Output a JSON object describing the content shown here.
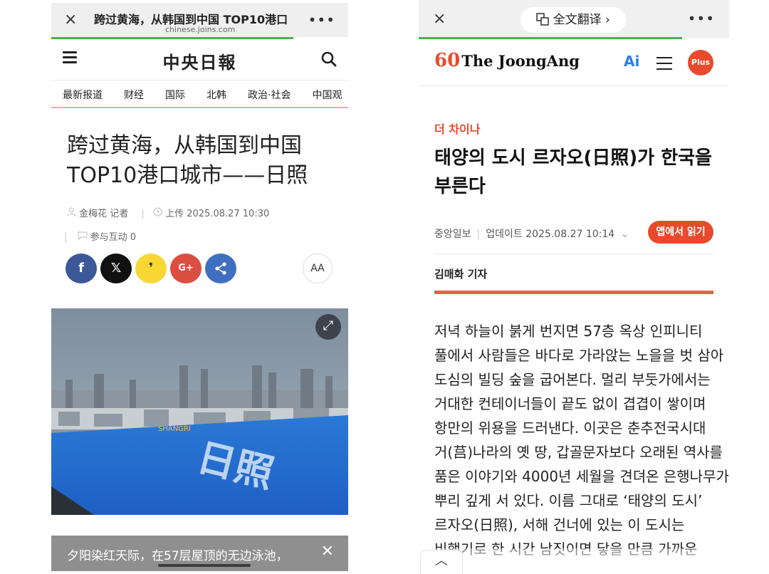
{
  "left": {
    "topbar": {
      "close_icon": "×",
      "title": "跨过黄海，从韩国到中国 TOP10港口",
      "domain": "chinese.joins.com",
      "more_icon": "•••"
    },
    "header": {
      "logo": "中央日報"
    },
    "nav": [
      "最新报道",
      "财经",
      "国际",
      "北韩",
      "政治·社会",
      "中国观"
    ],
    "headline": "跨过黄海，从韩国到中国TOP10港口城市——日照",
    "author": "金梅花 记者",
    "upload": "上传 2025.08.27 10:30",
    "comments": "参与互动 0",
    "share_colors": {
      "facebook": "#3b5998",
      "x": "#111111",
      "kakao": "#f7d733",
      "google": "#dc4e41",
      "share": "#3f6fc1"
    },
    "aa_label": "AA",
    "caption": "夕阳染红天际，在57层屋顶的无边泳池，"
  },
  "right": {
    "topbar": {
      "close_icon": "×",
      "translate": "全文翻译 ›",
      "more_icon": "•••"
    },
    "brand": {
      "sixty": "60",
      "name": "The JoongAng"
    },
    "plus": "Plus",
    "section": "더 차이나",
    "headline": "태양의 도시 르자오(日照)가 한국을 부른다",
    "source": "중앙일보",
    "updated": "업데이트 2025.08.27 10:14",
    "app_button": "앱에서 읽기",
    "reporter": "김매화 기자",
    "body_lines": [
      "저녁 하늘이 붉게 번지면 57층 옥상 인피니티",
      "풀에서 사람들은 바다로 가라앉는 노을을 벗 삼아",
      "도심의 빌딩 숲을 굽어본다. 멀리 부둣가에서는",
      "거대한 컨테이너들이 끝도 없이 겹겹이 쌓이며",
      "항만의 위용을 드러낸다. 이곳은 춘추전국시대",
      "거(莒)나라의 옛 땅, 갑골문자보다 오래된 역사를",
      "품은 이야기와 4000년 세월을 견뎌온 은행나무가",
      "뿌리 깊게 서 있다. 이름 그대로 ‘태양의 도시’",
      "르자오(日照), 서해 건너에 있는 이 도시는",
      "비행기로 한 시간 남짓이면 닿을 만큼 가까운"
    ],
    "accent_color": "#e84b2c"
  }
}
